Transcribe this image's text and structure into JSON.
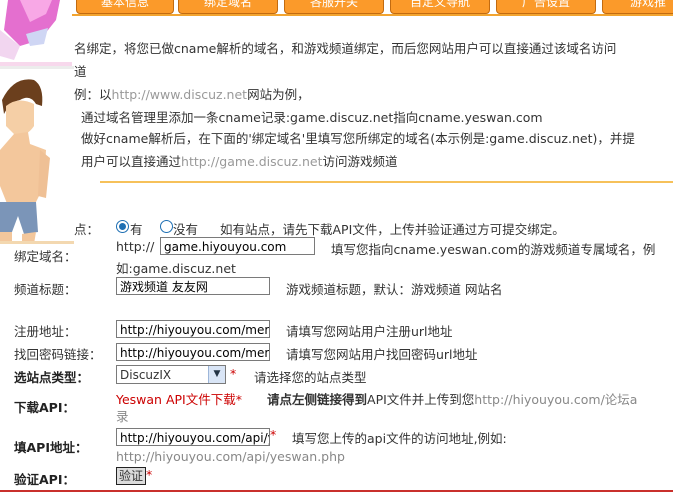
{
  "tabs": [
    {
      "label": "基本信息"
    },
    {
      "label": "绑定域名"
    },
    {
      "label": "各服开关"
    },
    {
      "label": "自定义导航"
    },
    {
      "label": "广告设置"
    },
    {
      "label": "游戏推"
    }
  ],
  "description": {
    "line1": "名绑定，将您已做cname解析的域名，和游戏频道绑定，而后您网站用户可以直接通过该域名访问",
    "line2": "道",
    "line3_prefix": "例：以",
    "line3_url": "http://www.discuz.net",
    "line3_suffix": "网站为例，",
    "line4": "通过域名管理里添加一条cname记录:game.discuz.net指向cname.yeswan.com",
    "line5": "做好cname解析后，在下面的'绑定域名'里填写您所绑定的域名(本示例是:game.discuz.net)，并提",
    "line6_prefix": "用户可以直接通过",
    "line6_url": "http://game.discuz.net",
    "line6_suffix": "访问游戏频道"
  },
  "form": {
    "site_label": "点：",
    "radio_yes": "有",
    "radio_no": "没有",
    "site_hint": "如有站点，请先下载API文件，上传并验证通过方可提交绑定。",
    "domain_label": "绑定域名：",
    "domain_prefix": "http://",
    "domain_value": "game.hiyouyou.com",
    "domain_hint": "填写您指向cname.yeswan.com的游戏频道专属域名，例",
    "domain_hint2": "如:game.discuz.net",
    "title_label": "频道标题：",
    "title_value": "游戏频道 友友网",
    "title_hint": "游戏频道标题，默认：游戏频道 网站名",
    "register_label": "注册地址：",
    "register_value": "http://hiyouyou.com/mem",
    "register_hint": "请填写您网站用户注册url地址",
    "recover_label": "找回密码链接：",
    "recover_value": "http://hiyouyou.com/mem",
    "recover_hint": "请填写您网站用户找回密码url地址",
    "type_label": "选站点类型：",
    "type_value": "DiscuzIX",
    "type_hint": "请选择您的站点类型",
    "download_label": "下载API：",
    "download_link": "Yeswan API文件下载",
    "download_hint_bold": "请点左侧链接得到",
    "download_hint": "API文件并上传到您",
    "download_hint_url": "http://hiyouyou.com/论坛a",
    "download_hint2": "录",
    "api_label": "填API地址：",
    "api_value": "http://hiyouyou.com/api/ye",
    "api_hint": "填写您上传的api文件的访问地址,例如:",
    "api_example": "http://hiyouyou.com/api/yeswan.php",
    "verify_label": "验证API：",
    "verify_button": "验证",
    "required_mark": "*"
  }
}
